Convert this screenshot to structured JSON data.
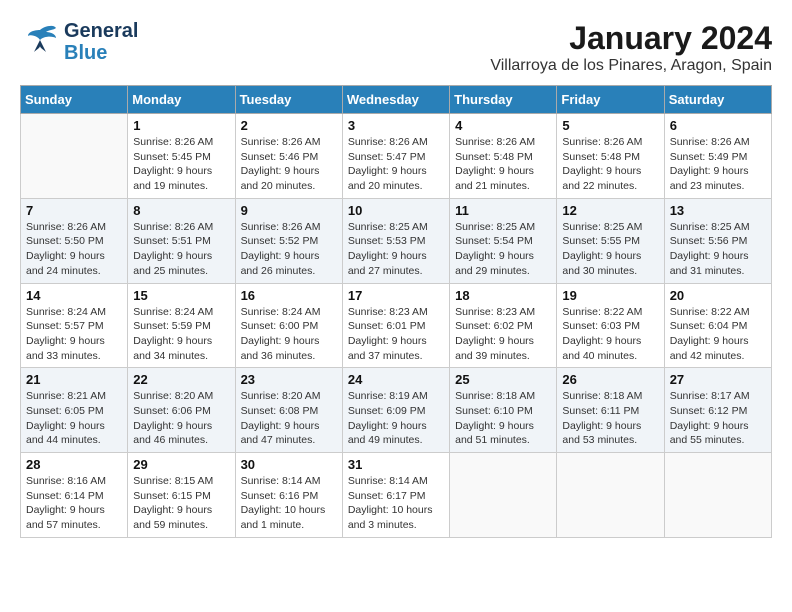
{
  "logo": {
    "general": "General",
    "blue": "Blue"
  },
  "title": "January 2024",
  "subtitle": "Villarroya de los Pinares, Aragon, Spain",
  "weekdays": [
    "Sunday",
    "Monday",
    "Tuesday",
    "Wednesday",
    "Thursday",
    "Friday",
    "Saturday"
  ],
  "weeks": [
    [
      {
        "num": "",
        "info": ""
      },
      {
        "num": "1",
        "info": "Sunrise: 8:26 AM\nSunset: 5:45 PM\nDaylight: 9 hours\nand 19 minutes."
      },
      {
        "num": "2",
        "info": "Sunrise: 8:26 AM\nSunset: 5:46 PM\nDaylight: 9 hours\nand 20 minutes."
      },
      {
        "num": "3",
        "info": "Sunrise: 8:26 AM\nSunset: 5:47 PM\nDaylight: 9 hours\nand 20 minutes."
      },
      {
        "num": "4",
        "info": "Sunrise: 8:26 AM\nSunset: 5:48 PM\nDaylight: 9 hours\nand 21 minutes."
      },
      {
        "num": "5",
        "info": "Sunrise: 8:26 AM\nSunset: 5:48 PM\nDaylight: 9 hours\nand 22 minutes."
      },
      {
        "num": "6",
        "info": "Sunrise: 8:26 AM\nSunset: 5:49 PM\nDaylight: 9 hours\nand 23 minutes."
      }
    ],
    [
      {
        "num": "7",
        "info": "Sunrise: 8:26 AM\nSunset: 5:50 PM\nDaylight: 9 hours\nand 24 minutes."
      },
      {
        "num": "8",
        "info": "Sunrise: 8:26 AM\nSunset: 5:51 PM\nDaylight: 9 hours\nand 25 minutes."
      },
      {
        "num": "9",
        "info": "Sunrise: 8:26 AM\nSunset: 5:52 PM\nDaylight: 9 hours\nand 26 minutes."
      },
      {
        "num": "10",
        "info": "Sunrise: 8:25 AM\nSunset: 5:53 PM\nDaylight: 9 hours\nand 27 minutes."
      },
      {
        "num": "11",
        "info": "Sunrise: 8:25 AM\nSunset: 5:54 PM\nDaylight: 9 hours\nand 29 minutes."
      },
      {
        "num": "12",
        "info": "Sunrise: 8:25 AM\nSunset: 5:55 PM\nDaylight: 9 hours\nand 30 minutes."
      },
      {
        "num": "13",
        "info": "Sunrise: 8:25 AM\nSunset: 5:56 PM\nDaylight: 9 hours\nand 31 minutes."
      }
    ],
    [
      {
        "num": "14",
        "info": "Sunrise: 8:24 AM\nSunset: 5:57 PM\nDaylight: 9 hours\nand 33 minutes."
      },
      {
        "num": "15",
        "info": "Sunrise: 8:24 AM\nSunset: 5:59 PM\nDaylight: 9 hours\nand 34 minutes."
      },
      {
        "num": "16",
        "info": "Sunrise: 8:24 AM\nSunset: 6:00 PM\nDaylight: 9 hours\nand 36 minutes."
      },
      {
        "num": "17",
        "info": "Sunrise: 8:23 AM\nSunset: 6:01 PM\nDaylight: 9 hours\nand 37 minutes."
      },
      {
        "num": "18",
        "info": "Sunrise: 8:23 AM\nSunset: 6:02 PM\nDaylight: 9 hours\nand 39 minutes."
      },
      {
        "num": "19",
        "info": "Sunrise: 8:22 AM\nSunset: 6:03 PM\nDaylight: 9 hours\nand 40 minutes."
      },
      {
        "num": "20",
        "info": "Sunrise: 8:22 AM\nSunset: 6:04 PM\nDaylight: 9 hours\nand 42 minutes."
      }
    ],
    [
      {
        "num": "21",
        "info": "Sunrise: 8:21 AM\nSunset: 6:05 PM\nDaylight: 9 hours\nand 44 minutes."
      },
      {
        "num": "22",
        "info": "Sunrise: 8:20 AM\nSunset: 6:06 PM\nDaylight: 9 hours\nand 46 minutes."
      },
      {
        "num": "23",
        "info": "Sunrise: 8:20 AM\nSunset: 6:08 PM\nDaylight: 9 hours\nand 47 minutes."
      },
      {
        "num": "24",
        "info": "Sunrise: 8:19 AM\nSunset: 6:09 PM\nDaylight: 9 hours\nand 49 minutes."
      },
      {
        "num": "25",
        "info": "Sunrise: 8:18 AM\nSunset: 6:10 PM\nDaylight: 9 hours\nand 51 minutes."
      },
      {
        "num": "26",
        "info": "Sunrise: 8:18 AM\nSunset: 6:11 PM\nDaylight: 9 hours\nand 53 minutes."
      },
      {
        "num": "27",
        "info": "Sunrise: 8:17 AM\nSunset: 6:12 PM\nDaylight: 9 hours\nand 55 minutes."
      }
    ],
    [
      {
        "num": "28",
        "info": "Sunrise: 8:16 AM\nSunset: 6:14 PM\nDaylight: 9 hours\nand 57 minutes."
      },
      {
        "num": "29",
        "info": "Sunrise: 8:15 AM\nSunset: 6:15 PM\nDaylight: 9 hours\nand 59 minutes."
      },
      {
        "num": "30",
        "info": "Sunrise: 8:14 AM\nSunset: 6:16 PM\nDaylight: 10 hours\nand 1 minute."
      },
      {
        "num": "31",
        "info": "Sunrise: 8:14 AM\nSunset: 6:17 PM\nDaylight: 10 hours\nand 3 minutes."
      },
      {
        "num": "",
        "info": ""
      },
      {
        "num": "",
        "info": ""
      },
      {
        "num": "",
        "info": ""
      }
    ]
  ]
}
